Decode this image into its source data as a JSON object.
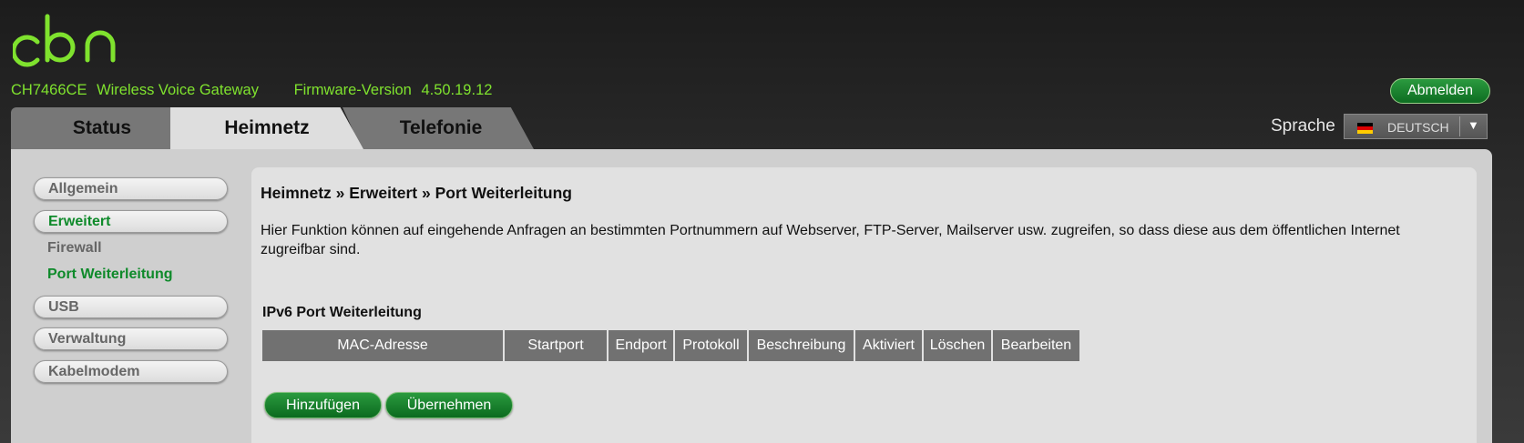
{
  "brand": {
    "logo_text": "cbn",
    "color": "#7fe22e"
  },
  "header": {
    "model": "CH7466CE",
    "product": "Wireless Voice Gateway",
    "firmware_label": "Firmware-Version",
    "firmware_value": "4.50.19.12",
    "logout_label": "Abmelden"
  },
  "tabs": [
    {
      "label": "Status"
    },
    {
      "label": "Heimnetz",
      "active": true
    },
    {
      "label": "Telefonie"
    }
  ],
  "language": {
    "label": "Sprache",
    "selected": "DEUTSCH",
    "flag_icon": "german-flag-icon"
  },
  "sidebar": {
    "items": [
      {
        "label": "Allgemein"
      },
      {
        "label": "Erweitert",
        "active": true
      },
      {
        "label": "USB"
      },
      {
        "label": "Verwaltung"
      },
      {
        "label": "Kabelmodem"
      }
    ],
    "subitems": [
      {
        "label": "Firewall"
      },
      {
        "label": "Port Weiterleitung",
        "active": true
      }
    ]
  },
  "main": {
    "breadcrumb": "Heimnetz » Erweitert » Port Weiterleitung",
    "description": "Hier Funktion können auf eingehende Anfragen an bestimmten Portnummern auf Webserver, FTP-Server, Mailserver usw. zugreifen, so dass diese aus dem öffentlichen Internet zugreifbar sind.",
    "section_title": "IPv6 Port Weiterleitung",
    "table_headers": [
      "MAC-Adresse",
      "Startport",
      "Endport",
      "Protokoll",
      "Beschreibung",
      "Aktiviert",
      "Löschen",
      "Bearbeiten"
    ],
    "buttons": {
      "add": "Hinzufügen",
      "apply": "Übernehmen"
    }
  },
  "colors": {
    "accent_green": "#0e8a2a",
    "header_gray": "#717171"
  }
}
